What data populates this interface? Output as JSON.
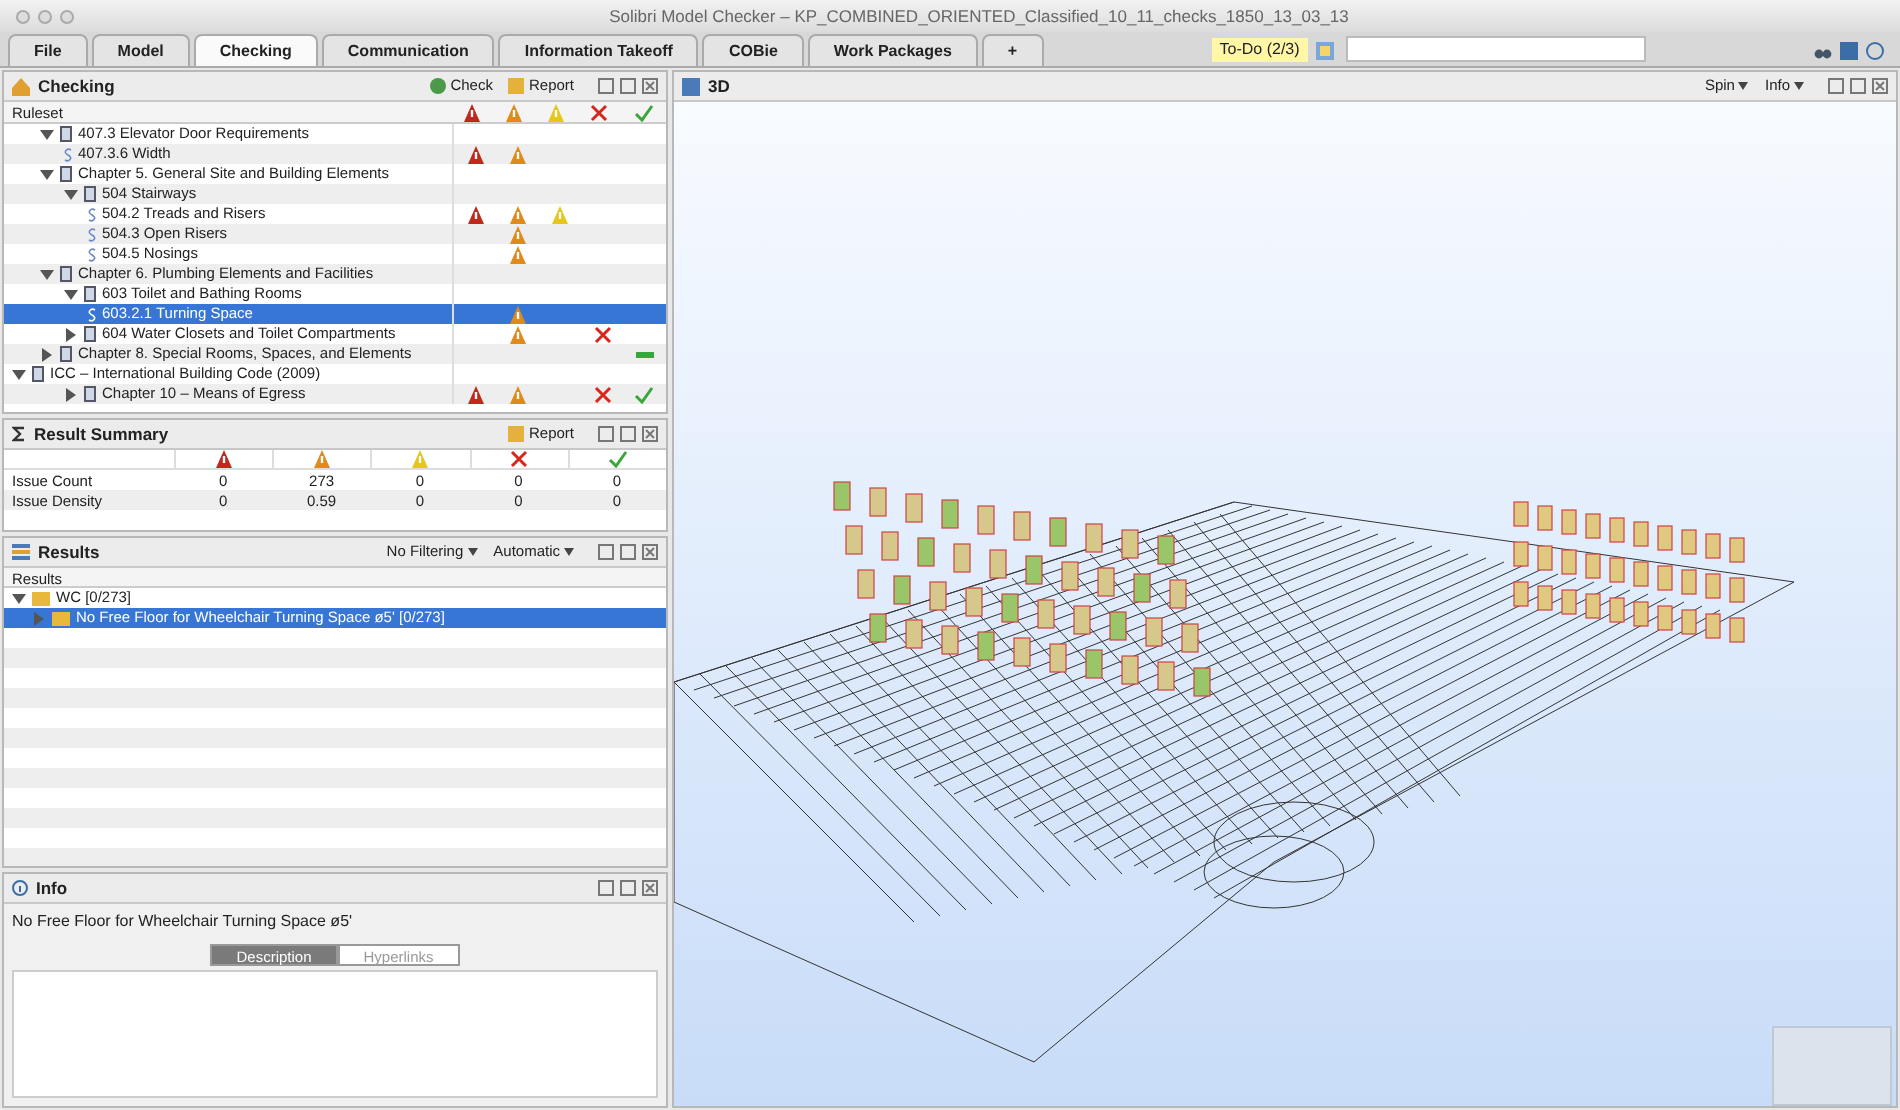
{
  "window": {
    "title": "Solibri Model Checker – KP_COMBINED_ORIENTED_Classified_10_11_checks_1850_13_03_13"
  },
  "tabs": [
    {
      "label": "File",
      "selected": false
    },
    {
      "label": "Model",
      "selected": false
    },
    {
      "label": "Checking",
      "selected": true
    },
    {
      "label": "Communication",
      "selected": false
    },
    {
      "label": "Information Takeoff",
      "selected": false
    },
    {
      "label": "COBie",
      "selected": false
    },
    {
      "label": "Work Packages",
      "selected": false
    },
    {
      "label": "+",
      "selected": false
    }
  ],
  "todo": {
    "label": "To-Do (2/3)"
  },
  "checking": {
    "title": "Checking",
    "check_button": "Check",
    "report_button": "Report",
    "column_header": "Ruleset",
    "tree": [
      {
        "label": "407.3 Elevator Door Requirements",
        "kind": "chapter",
        "expanded": true,
        "selected": false,
        "critical": false,
        "moderate": false,
        "low": false,
        "rejected": false,
        "passed": false,
        "partial": false,
        "children": [
          {
            "label": "407.3.6 Width",
            "kind": "rule",
            "selected": false,
            "critical": true,
            "moderate": true,
            "low": false,
            "rejected": false,
            "passed": false,
            "partial": false
          }
        ]
      },
      {
        "label": "Chapter 5. General Site and Building Elements",
        "kind": "chapter",
        "expanded": true,
        "selected": false,
        "critical": false,
        "moderate": false,
        "low": false,
        "rejected": false,
        "passed": false,
        "partial": false,
        "children": [
          {
            "label": "504 Stairways",
            "kind": "chapter",
            "expanded": true,
            "selected": false,
            "critical": false,
            "moderate": false,
            "low": false,
            "rejected": false,
            "passed": false,
            "partial": false,
            "children": [
              {
                "label": "504.2 Treads and Risers",
                "kind": "rule",
                "selected": false,
                "critical": true,
                "moderate": true,
                "low": true,
                "rejected": false,
                "passed": false,
                "partial": false
              },
              {
                "label": "504.3 Open Risers",
                "kind": "rule",
                "selected": false,
                "critical": false,
                "moderate": true,
                "low": false,
                "rejected": false,
                "passed": false,
                "partial": false
              },
              {
                "label": "504.5 Nosings",
                "kind": "rule",
                "selected": false,
                "critical": false,
                "moderate": true,
                "low": false,
                "rejected": false,
                "passed": false,
                "partial": false
              }
            ]
          }
        ]
      },
      {
        "label": "Chapter 6. Plumbing Elements and Facilities",
        "kind": "chapter",
        "expanded": true,
        "selected": false,
        "critical": false,
        "moderate": false,
        "low": false,
        "rejected": false,
        "passed": false,
        "partial": false,
        "children": [
          {
            "label": "603 Toilet and Bathing Rooms",
            "kind": "chapter",
            "expanded": true,
            "selected": false,
            "critical": false,
            "moderate": false,
            "low": false,
            "rejected": false,
            "passed": false,
            "partial": false,
            "children": [
              {
                "label": "603.2.1 Turning Space",
                "kind": "rule",
                "selected": true,
                "critical": false,
                "moderate": true,
                "low": false,
                "rejected": false,
                "passed": false,
                "partial": false
              }
            ]
          },
          {
            "label": "604 Water Closets and Toilet Compartments",
            "kind": "chapter",
            "expanded": false,
            "selected": false,
            "critical": false,
            "moderate": true,
            "low": false,
            "rejected": true,
            "passed": false,
            "partial": false
          }
        ]
      },
      {
        "label": "Chapter 8. Special Rooms, Spaces, and Elements",
        "kind": "chapter",
        "expanded": false,
        "selected": false,
        "critical": false,
        "moderate": false,
        "low": false,
        "rejected": false,
        "passed": false,
        "partial": true
      },
      {
        "label": "ICC – International Building Code (2009)",
        "kind": "root",
        "expanded": true,
        "selected": false,
        "critical": false,
        "moderate": false,
        "low": false,
        "rejected": false,
        "passed": false,
        "partial": false,
        "children": [
          {
            "label": "Chapter 10 – Means of Egress",
            "kind": "chapter",
            "expanded": false,
            "selected": false,
            "critical": true,
            "moderate": true,
            "low": false,
            "rejected": true,
            "passed": true,
            "partial": false
          }
        ]
      }
    ]
  },
  "summary": {
    "title": "Result Summary",
    "report_button": "Report",
    "rows": [
      {
        "label": "Issue Count",
        "values": [
          "0",
          "273",
          "0",
          "0",
          "0"
        ]
      },
      {
        "label": "Issue Density",
        "values": [
          "0",
          "0.59",
          "0",
          "0",
          "0"
        ]
      }
    ]
  },
  "results": {
    "title": "Results",
    "filter": "No Filtering",
    "mode": "Automatic",
    "column_header": "Results",
    "tree": [
      {
        "label": "WC [0/273]",
        "expanded": true,
        "selected": false,
        "children": [
          {
            "label": "No Free Floor for Wheelchair Turning Space ø5' [0/273]",
            "expanded": false,
            "selected": true
          }
        ]
      }
    ]
  },
  "info": {
    "title": "Info",
    "heading": "No Free Floor for Wheelchair Turning Space ø5'",
    "tabs": [
      {
        "label": "Description",
        "selected": true
      },
      {
        "label": "Hyperlinks",
        "selected": false
      }
    ]
  },
  "view3d": {
    "title": "3D",
    "spin": "Spin",
    "info": "Info"
  }
}
